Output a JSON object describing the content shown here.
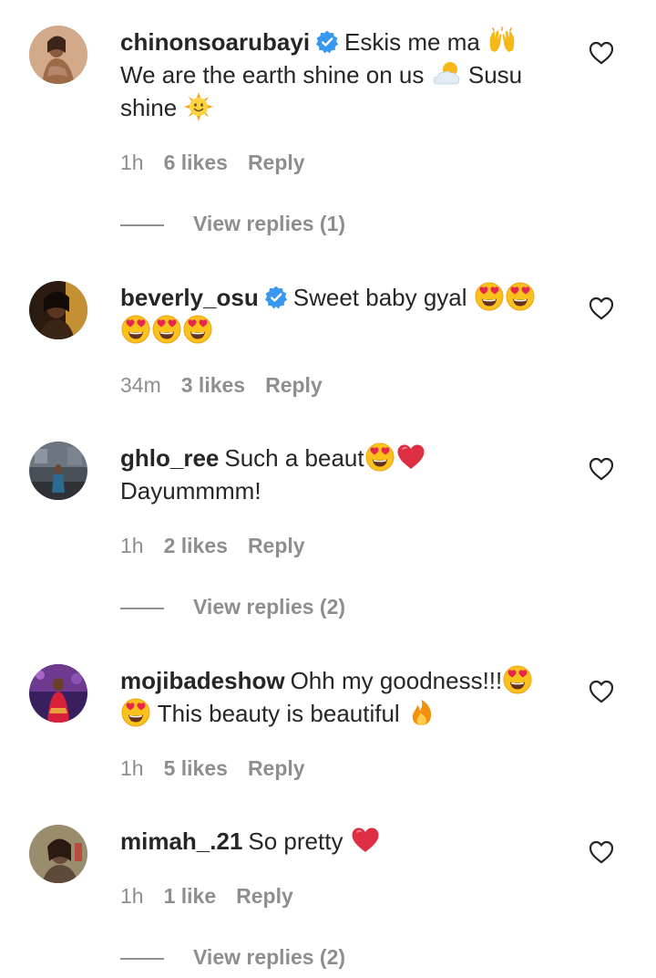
{
  "comments": [
    {
      "username": "chinonsoarubayi",
      "verified": true,
      "text_parts": [
        "Eskis me ma",
        "We are the earth shine on us",
        "Susu shine"
      ],
      "time": "1h",
      "likes": "6 likes",
      "reply": "Reply",
      "view_replies": "View replies (1)"
    },
    {
      "username": "beverly_osu",
      "verified": true,
      "text_parts": [
        "Sweet baby gyal"
      ],
      "time": "34m",
      "likes": "3 likes",
      "reply": "Reply"
    },
    {
      "username": "ghlo_ree",
      "verified": false,
      "text_parts": [
        "Such a beaut",
        "Dayummmm!"
      ],
      "time": "1h",
      "likes": "2 likes",
      "reply": "Reply",
      "view_replies": "View replies (2)"
    },
    {
      "username": "mojibadeshow",
      "verified": false,
      "text_parts": [
        "Ohh my goodness!!!",
        "This beauty is beautiful"
      ],
      "time": "1h",
      "likes": "5 likes",
      "reply": "Reply"
    },
    {
      "username": "mimah_.21",
      "verified": false,
      "text_parts": [
        "So pretty"
      ],
      "time": "1h",
      "likes": "1 like",
      "reply": "Reply",
      "view_replies": "View replies (2)"
    }
  ],
  "icons": {
    "verified": "verified-badge-icon",
    "heart": "heart-outline-icon",
    "raised_hands": "raised-hands-emoji",
    "sun_cloud": "sun-behind-cloud-emoji",
    "sun_face": "sun-with-face-emoji",
    "heart_eyes": "heart-eyes-emoji",
    "red_heart": "red-heart-emoji",
    "fire": "fire-emoji"
  },
  "colors": {
    "text": "#262626",
    "secondary": "#8e8e8e",
    "verified_blue": "#3897f0"
  }
}
